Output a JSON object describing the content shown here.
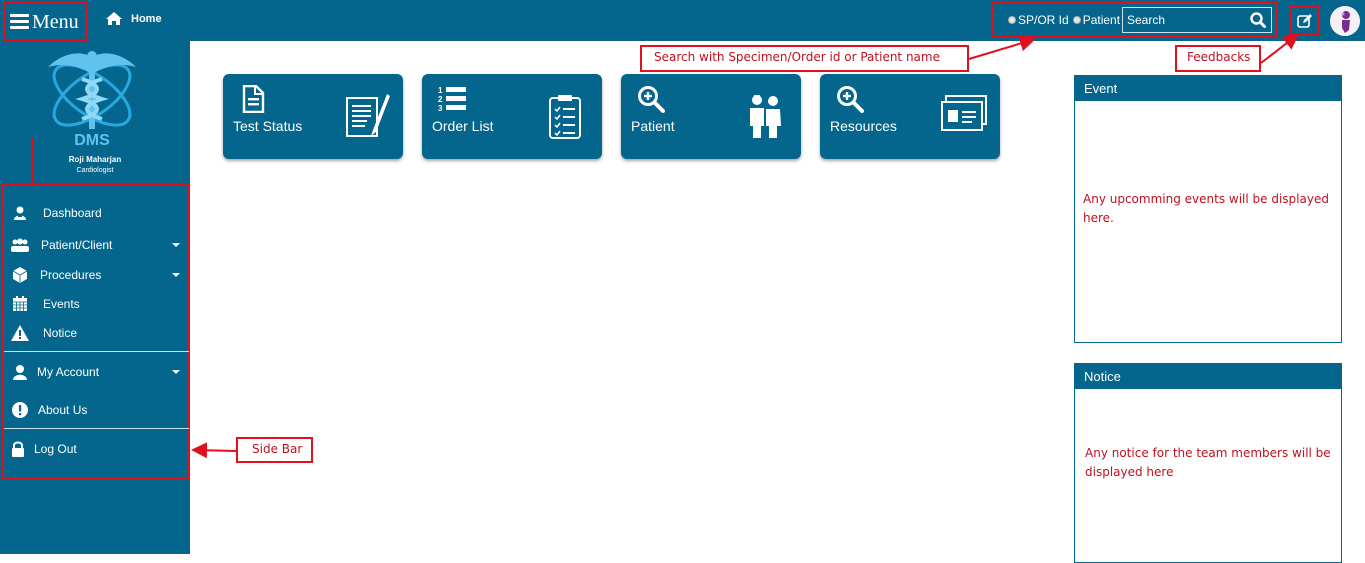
{
  "topbar": {
    "menu_label": "Menu",
    "home_label": "Home",
    "search": {
      "option_specimen": "SP/OR Id",
      "option_patient": "Patient",
      "placeholder": "Search"
    }
  },
  "sidebar": {
    "user_name": "Roji Maharjan",
    "user_role": "Cardiologist",
    "logo_text": "DMS",
    "items": [
      {
        "label": "Dashboard",
        "icon": "user-group-icon",
        "has_dropdown": false
      },
      {
        "label": "Patient/Client",
        "icon": "users-icon",
        "has_dropdown": true
      },
      {
        "label": "Procedures",
        "icon": "cube-icon",
        "has_dropdown": true
      },
      {
        "label": "Events",
        "icon": "calendar-icon",
        "has_dropdown": false
      },
      {
        "label": "Notice",
        "icon": "warning-icon",
        "has_dropdown": false
      },
      {
        "label": "My Account",
        "icon": "user-icon",
        "has_dropdown": true
      },
      {
        "label": "About Us",
        "icon": "exclamation-icon",
        "has_dropdown": false
      },
      {
        "label": "Log Out",
        "icon": "lock-icon",
        "has_dropdown": false
      }
    ]
  },
  "tiles": [
    {
      "label": "Test Status",
      "icon": "document-icon"
    },
    {
      "label": "Order List",
      "icon": "numbered-list-icon"
    },
    {
      "label": "Patient",
      "icon": "magnifier-icon"
    },
    {
      "label": "Resources",
      "icon": "magnifier-icon"
    }
  ],
  "panels": {
    "event": {
      "title": "Event",
      "body": "Any upcomming events will be displayed here."
    },
    "notice": {
      "title": "Notice",
      "body": "Any notice for the team members will be displayed here"
    }
  },
  "callouts": {
    "search": "Search with Specimen/Order id or Patient name",
    "feedbacks": "Feedbacks",
    "sidebar": "Side Bar"
  },
  "colors": {
    "primary": "#05668d",
    "annotation_red": "#e0101e"
  }
}
